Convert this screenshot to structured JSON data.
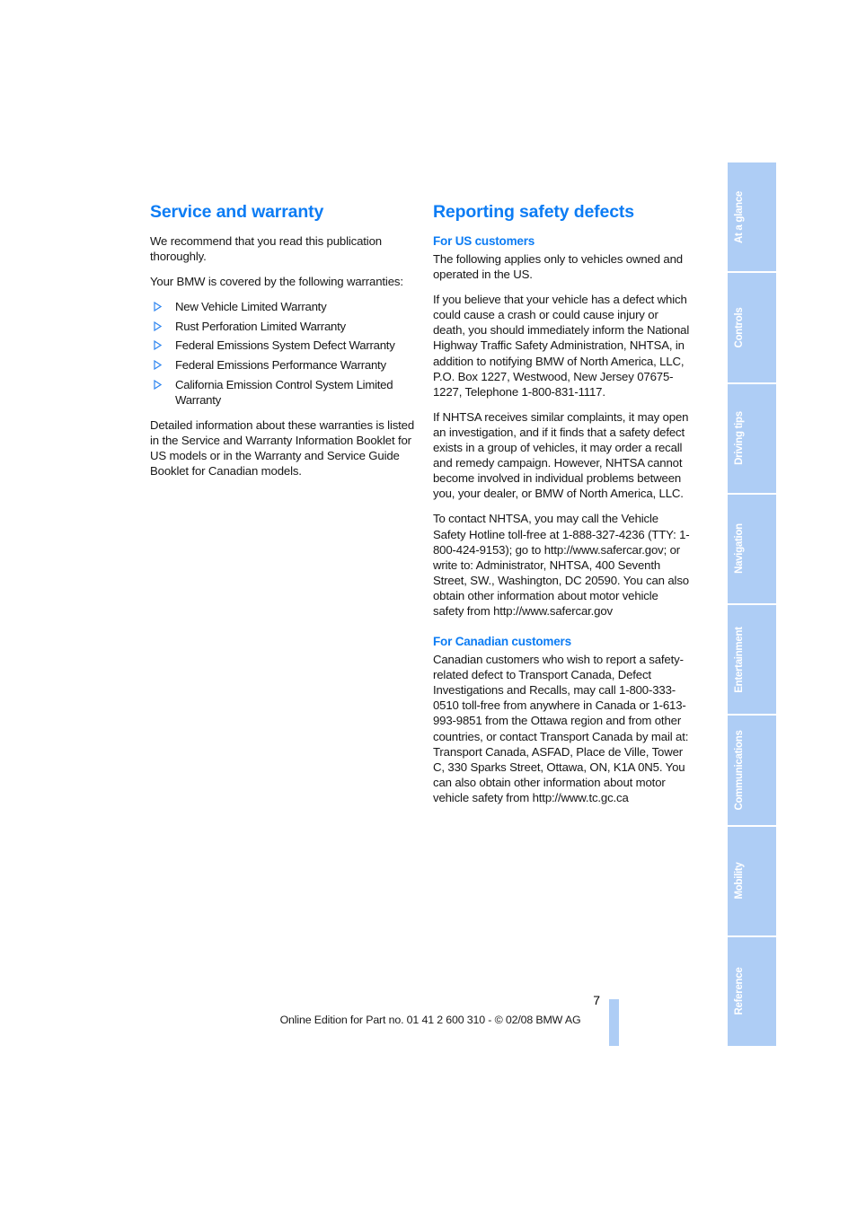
{
  "document": {
    "page_number": "7",
    "footer_note": "Online Edition for Part no. 01 41 2 600 310 - © 02/08 BMW AG"
  },
  "left_column": {
    "heading": "Service and warranty",
    "intro_paragraph": "We recommend that you read this publication thoroughly.",
    "lead_in": "Your BMW is covered by the following warranties:",
    "warranties": [
      "New Vehicle Limited Warranty",
      "Rust Perforation Limited Warranty",
      "Federal Emissions System Defect Warranty",
      "Federal Emissions Performance Warranty",
      "California Emission Control System Limited Warranty"
    ],
    "closing_paragraph": "Detailed information about these warranties is listed in the Service and Warranty Information Booklet for US models or in the Warranty and Service Guide Booklet for Canadian models."
  },
  "right_column": {
    "heading": "Reporting safety defects",
    "us_section": {
      "subheading": "For US customers",
      "paragraph_1": "The following applies only to vehicles owned and operated in the US.",
      "paragraph_2": "If you believe that your vehicle has a defect which could cause a crash or could cause injury or death, you should immediately inform the National Highway Traffic Safety Administration, NHTSA, in addition to notifying BMW of North America, LLC, P.O. Box 1227, Westwood, New Jersey 07675-1227, Telephone 1-800-831-1117.",
      "paragraph_3": "If NHTSA receives similar complaints, it may open an investigation, and if it finds that a safety defect exists in a group of vehicles, it may order a recall and remedy campaign. However, NHTSA cannot become involved in individual problems between you, your dealer, or BMW of North America, LLC.",
      "paragraph_4": "To contact NHTSA, you may call the Vehicle Safety Hotline toll-free at 1-888-327-4236 (TTY: 1-800-424-9153); go to http://www.safercar.gov; or write to: Administrator, NHTSA, 400 Seventh Street, SW., Washington, DC 20590. You can also obtain other information about motor vehicle safety from http://www.safercar.gov"
    },
    "canada_section": {
      "subheading": "For Canadian customers",
      "paragraph_1": "Canadian customers who wish to report a safety-related defect to Transport Canada, Defect Investigations and Recalls, may call 1-800-333-0510 toll-free from anywhere in Canada or 1-613-993-9851 from the Ottawa region and from other countries, or contact Transport Canada by mail at: Transport Canada, ASFAD, Place de Ville, Tower C, 330 Sparks Street, Ottawa, ON, K1A 0N5. You can also obtain other information about motor vehicle safety from http://www.tc.gc.ca"
    }
  },
  "tab_strip": {
    "tabs": [
      {
        "label": "At a glance"
      },
      {
        "label": "Controls"
      },
      {
        "label": "Driving tips"
      },
      {
        "label": "Navigation"
      },
      {
        "label": "Entertainment"
      },
      {
        "label": "Communications"
      },
      {
        "label": "Mobility"
      },
      {
        "label": "Reference"
      }
    ]
  },
  "colors": {
    "heading_blue": "#0c7cf4",
    "tab_blue": "#aecdf5",
    "bullet_blue": "#2f86f0"
  }
}
